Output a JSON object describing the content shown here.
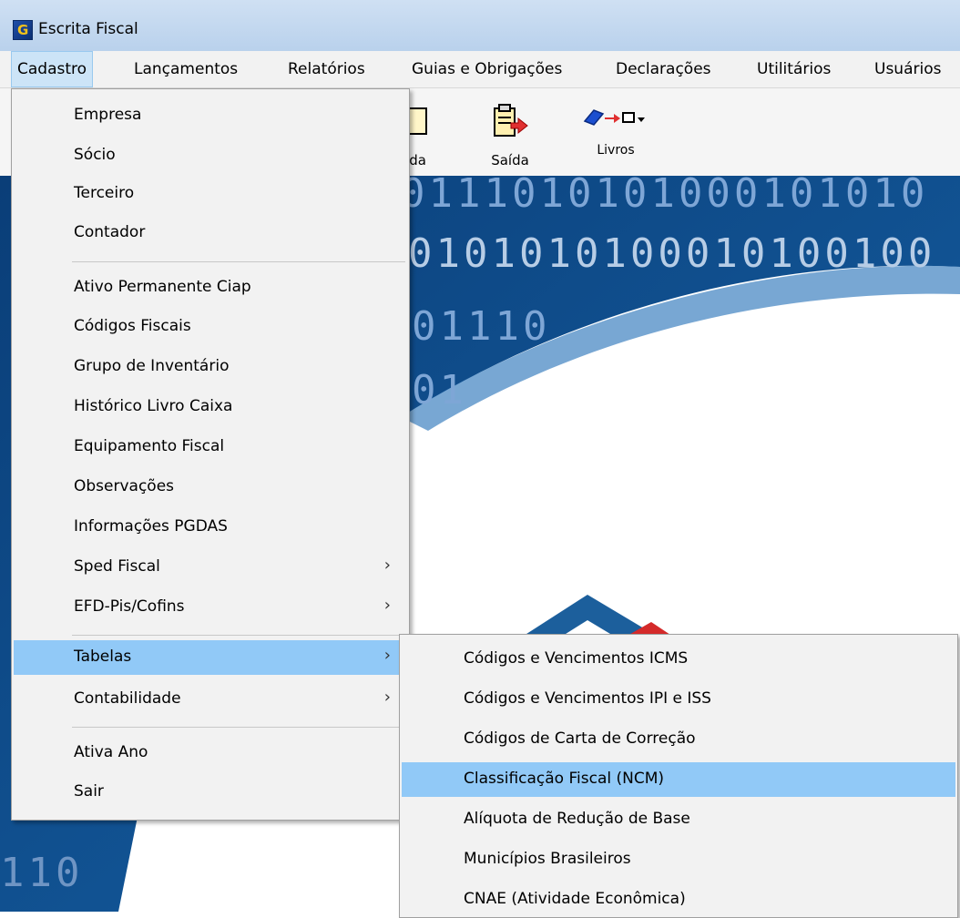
{
  "window": {
    "title": "Escrita Fiscal"
  },
  "menubar": [
    "Cadastro",
    "Lançamentos",
    "Relatórios",
    "Guias e Obrigações",
    "Declarações",
    "Utilitários",
    "Usuários"
  ],
  "toolbar": {
    "partial_label": "ada",
    "saida_label": "Saída",
    "livros_label": "Livros"
  },
  "background": {
    "binary_rows": [
      "0111010101000101010",
      "0101010100010100100",
      "01110",
      "01",
      "110"
    ]
  },
  "cadastro_menu": {
    "group1": [
      "Empresa",
      "Sócio",
      "Terceiro",
      "Contador"
    ],
    "group2": [
      "Ativo Permanente  Ciap",
      "Códigos Fiscais",
      "Grupo de Inventário",
      "Histórico Livro Caixa",
      "Equipamento Fiscal",
      "Observações",
      "Informações PGDAS",
      "Sped Fiscal",
      "EFD-Pis/Cofins"
    ],
    "group3": [
      "Tabelas",
      "Contabilidade"
    ],
    "group4": [
      "Ativa Ano",
      "Sair"
    ]
  },
  "tabelas_submenu": [
    "Códigos e Vencimentos ICMS",
    "Códigos e Vencimentos  IPI  e  ISS",
    "Códigos de Carta de Correção",
    "Classificação Fiscal  (NCM)",
    "Alíquota de Redução de Base",
    "Municípios Brasileiros",
    "CNAE (Atividade Econômica)"
  ],
  "colors": {
    "highlight": "#91c9f7",
    "logo_blue": "#1c5f9c",
    "logo_red": "#d42a2a",
    "banner_blue": "#0d4f93"
  }
}
